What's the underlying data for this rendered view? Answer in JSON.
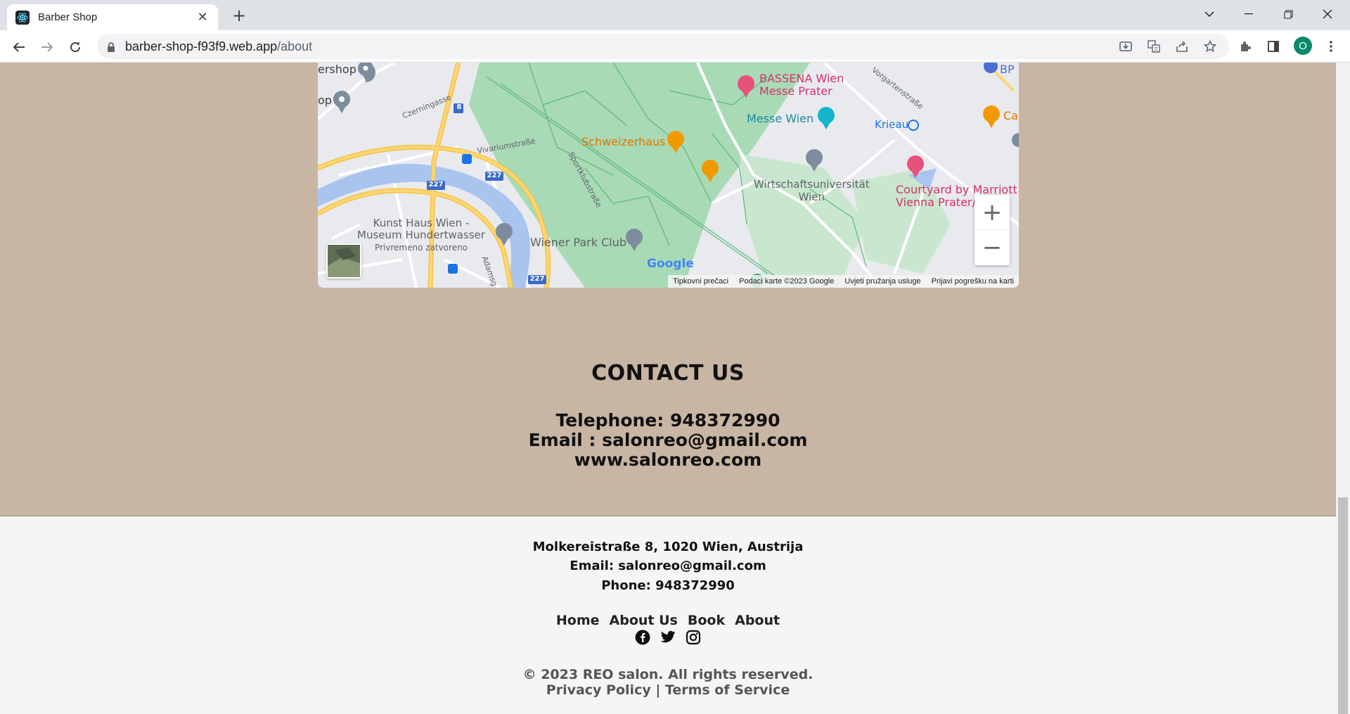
{
  "browser": {
    "tab_title": "Barber Shop",
    "url_domain": "barber-shop-f93f9.web.app",
    "url_path": "/about",
    "profile_initial": "O"
  },
  "map": {
    "labels": {
      "shop1": "ershop",
      "bassena1": "BASSENA Wien",
      "bassena2": "Messe Prater",
      "messe": "Messe Wien",
      "krieau": "Krieau",
      "schweizerhaus": "Schweizerhaus",
      "wu1": "Wirtschaftsuniversität",
      "wu2": "Wien",
      "courtyard1": "Courtyard by Marriott",
      "courtyard2": "Vienna Prater/",
      "kunsthaus1": "Kunst Haus Wien -",
      "kunsthaus2": "Museum Hundertwasser",
      "kunsthaus3": "Privremeno zatvoreno",
      "parkclub": "Wiener Park Club",
      "czerningasse": "Czerningasse",
      "vivarium": "Vivariumstraße",
      "sportklub": "Sportklubstraße",
      "vorgarten": "Vorgartenstraße",
      "adamsg": "Adamsg",
      "road8": "8",
      "road227a": "227",
      "road227b": "227",
      "road227c": "227",
      "bp": "BP",
      "ca": "Ca",
      "google": "Google",
      "op": "op"
    },
    "zoom_in": "+",
    "zoom_out": "−",
    "attribution": [
      "Tipkovni prečaci",
      "Podaci karte ©2023 Google",
      "Uvjeti pružanja usluge",
      "Prijavi pogrešku na karti"
    ]
  },
  "contact": {
    "title": "CONTACT US",
    "telephone": "Telephone: 948372990",
    "email": "Email : salonreo@gmail.com",
    "website": "www.salonreo.com"
  },
  "footer": {
    "address": "Molkereistraße 8, 1020 Wien, Austrija",
    "email": "Email: salonreo@gmail.com",
    "phone": "Phone: 948372990",
    "links": [
      "Home",
      "About Us",
      "Book",
      "About"
    ],
    "social_icons": [
      "facebook-icon",
      "twitter-icon",
      "instagram-icon"
    ],
    "copyright": "© 2023 REO salon. All rights reserved.",
    "policy": "Privacy Policy | Terms of Service"
  },
  "colors": {
    "contact_bg": "#c8b5a3",
    "footer_bg": "#f5f5f5",
    "map_park": "#a8dab5",
    "map_water": "#aac4f0",
    "map_road": "#fbd674"
  }
}
